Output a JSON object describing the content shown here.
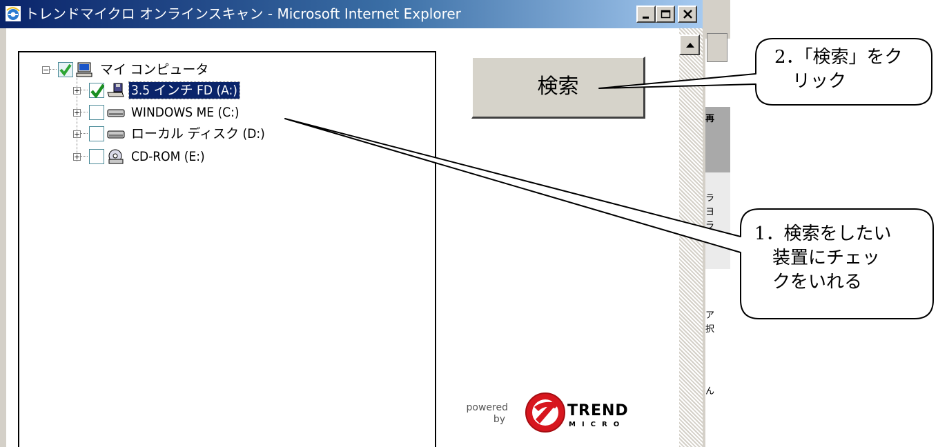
{
  "window": {
    "title": "トレンドマイクロ オンラインスキャン - Microsoft Internet Explorer",
    "controls": [
      "minimize-icon",
      "maximize-icon",
      "close-icon"
    ]
  },
  "tree": {
    "root": {
      "label": "マイ コンピュータ",
      "checked": true,
      "icon": "computer-icon"
    },
    "drives": [
      {
        "label": "3.5 インチ FD (A:)",
        "checked": true,
        "selected": true,
        "icon": "floppy-drive-icon"
      },
      {
        "label": "WINDOWS ME (C:)",
        "checked": false,
        "icon": "hard-drive-icon"
      },
      {
        "label": "ローカル ディスク (D:)",
        "checked": false,
        "icon": "hard-drive-icon"
      },
      {
        "label": "CD-ROM (E:)",
        "checked": false,
        "icon": "cd-drive-icon"
      }
    ]
  },
  "search_button": {
    "label": "検索"
  },
  "branding": {
    "powered": "powered",
    "by": "by",
    "brand": "TREND",
    "brand_sub": "MICRO",
    "brand_color": "#d7161e"
  },
  "background_window": {
    "fragments": [
      "再",
      "ラ",
      "ヨ",
      "ラ",
      "ア",
      "択",
      "ん"
    ]
  },
  "callouts": {
    "search": "2．「検索」をク\n　リック",
    "select": "1．検索をしたい\n　装置にチェッ\n　クをいれる"
  }
}
